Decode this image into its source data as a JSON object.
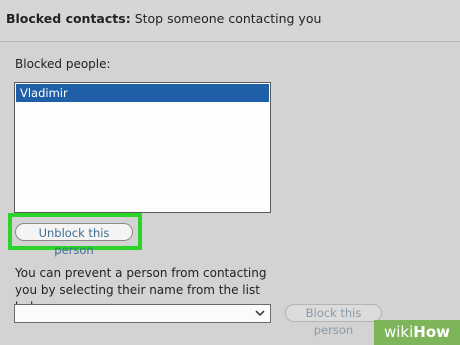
{
  "header": {
    "bold_label": "Blocked contacts:",
    "subtitle": "Stop someone contacting you"
  },
  "blocked": {
    "label": "Blocked people:",
    "items": [
      {
        "name": "Vladimir",
        "selected": true
      }
    ]
  },
  "unblock_button": "Unblock this person",
  "prevent": {
    "description": "You can prevent a person from contacting you by selecting their name from the list below.",
    "select_value": ""
  },
  "block_button": "Block this person",
  "watermark": {
    "part1": "wiki",
    "part2": "How"
  },
  "colors": {
    "highlight": "#2bd428",
    "selection": "#1f5fa8",
    "watermark_bg": "#7fb55a"
  }
}
